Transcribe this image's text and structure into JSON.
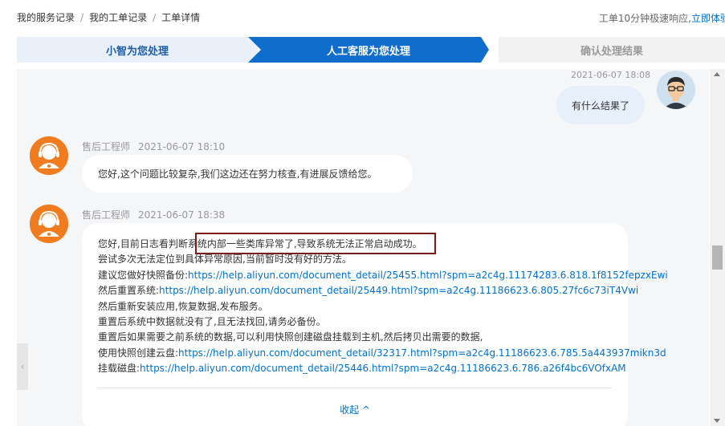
{
  "breadcrumb": {
    "items": [
      "我的服务记录",
      "我的工单记录",
      "工单详情"
    ],
    "separator": "/"
  },
  "notice": {
    "text": "工单10分钟极速响应,",
    "link": "立即体验"
  },
  "steps": [
    {
      "label": "小智为您处理",
      "state": "done"
    },
    {
      "label": "人工客服为您处理",
      "state": "active"
    },
    {
      "label": "确认处理结果",
      "state": "pending"
    }
  ],
  "user_message": {
    "time": "2021-06-07 18:08",
    "text": "有什么结果了"
  },
  "messages": [
    {
      "sender": "售后工程师",
      "time": "2021-06-07 18:10",
      "text": "您好,这个问题比较复杂,我们这边还在努力核查,有进展反馈给您。"
    },
    {
      "sender": "售后工程师",
      "time": "2021-06-07 18:38",
      "lines": [
        {
          "text": "您好,目前日志看判断系统内部一些类库异常了,导致系统无法正常启动成功。"
        },
        {
          "text": "尝试多次无法定位到具体异常原因,当前暂时没有好的方法。"
        },
        {
          "text": "建议您做好快照备份:",
          "link": "https://help.aliyun.com/document_detail/25455.html?spm=a2c4g.11174283.6.818.1f8152fepzxEwi"
        },
        {
          "text": "然后重置系统:",
          "link": "https://help.aliyun.com/document_detail/25449.html?spm=a2c4g.11186623.6.805.27fc6c73iT4Vwi"
        },
        {
          "text": "然后重新安装应用,恢复数据,发布服务。"
        },
        {
          "text": "重置后系统中数据就没有了,且无法找回,请务必备份。"
        },
        {
          "text": "重置后如果需要之前系统的数据,可以利用快照创建磁盘挂载到主机,然后拷贝出需要的数据,"
        },
        {
          "text": "使用快照创建云盘:",
          "link": "https://help.aliyun.com/document_detail/32317.html?spm=a2c4g.11186623.6.785.5a443937mikn3d"
        },
        {
          "text": "挂载磁盘:",
          "link": "https://help.aliyun.com/document_detail/25446.html?spm=a2c4g.11186623.6.786.a26f4bc6VOfxAM"
        }
      ],
      "collapse_label": "收起 ^"
    }
  ],
  "colors": {
    "accent": "#0f6dcc",
    "link": "#0070cc",
    "engineer_avatar": "#f07c1f",
    "highlight_box": "#7a1c1c"
  },
  "icons": {
    "collapse": "chevron-up-icon",
    "left_tab": "chevron-left-icon"
  }
}
